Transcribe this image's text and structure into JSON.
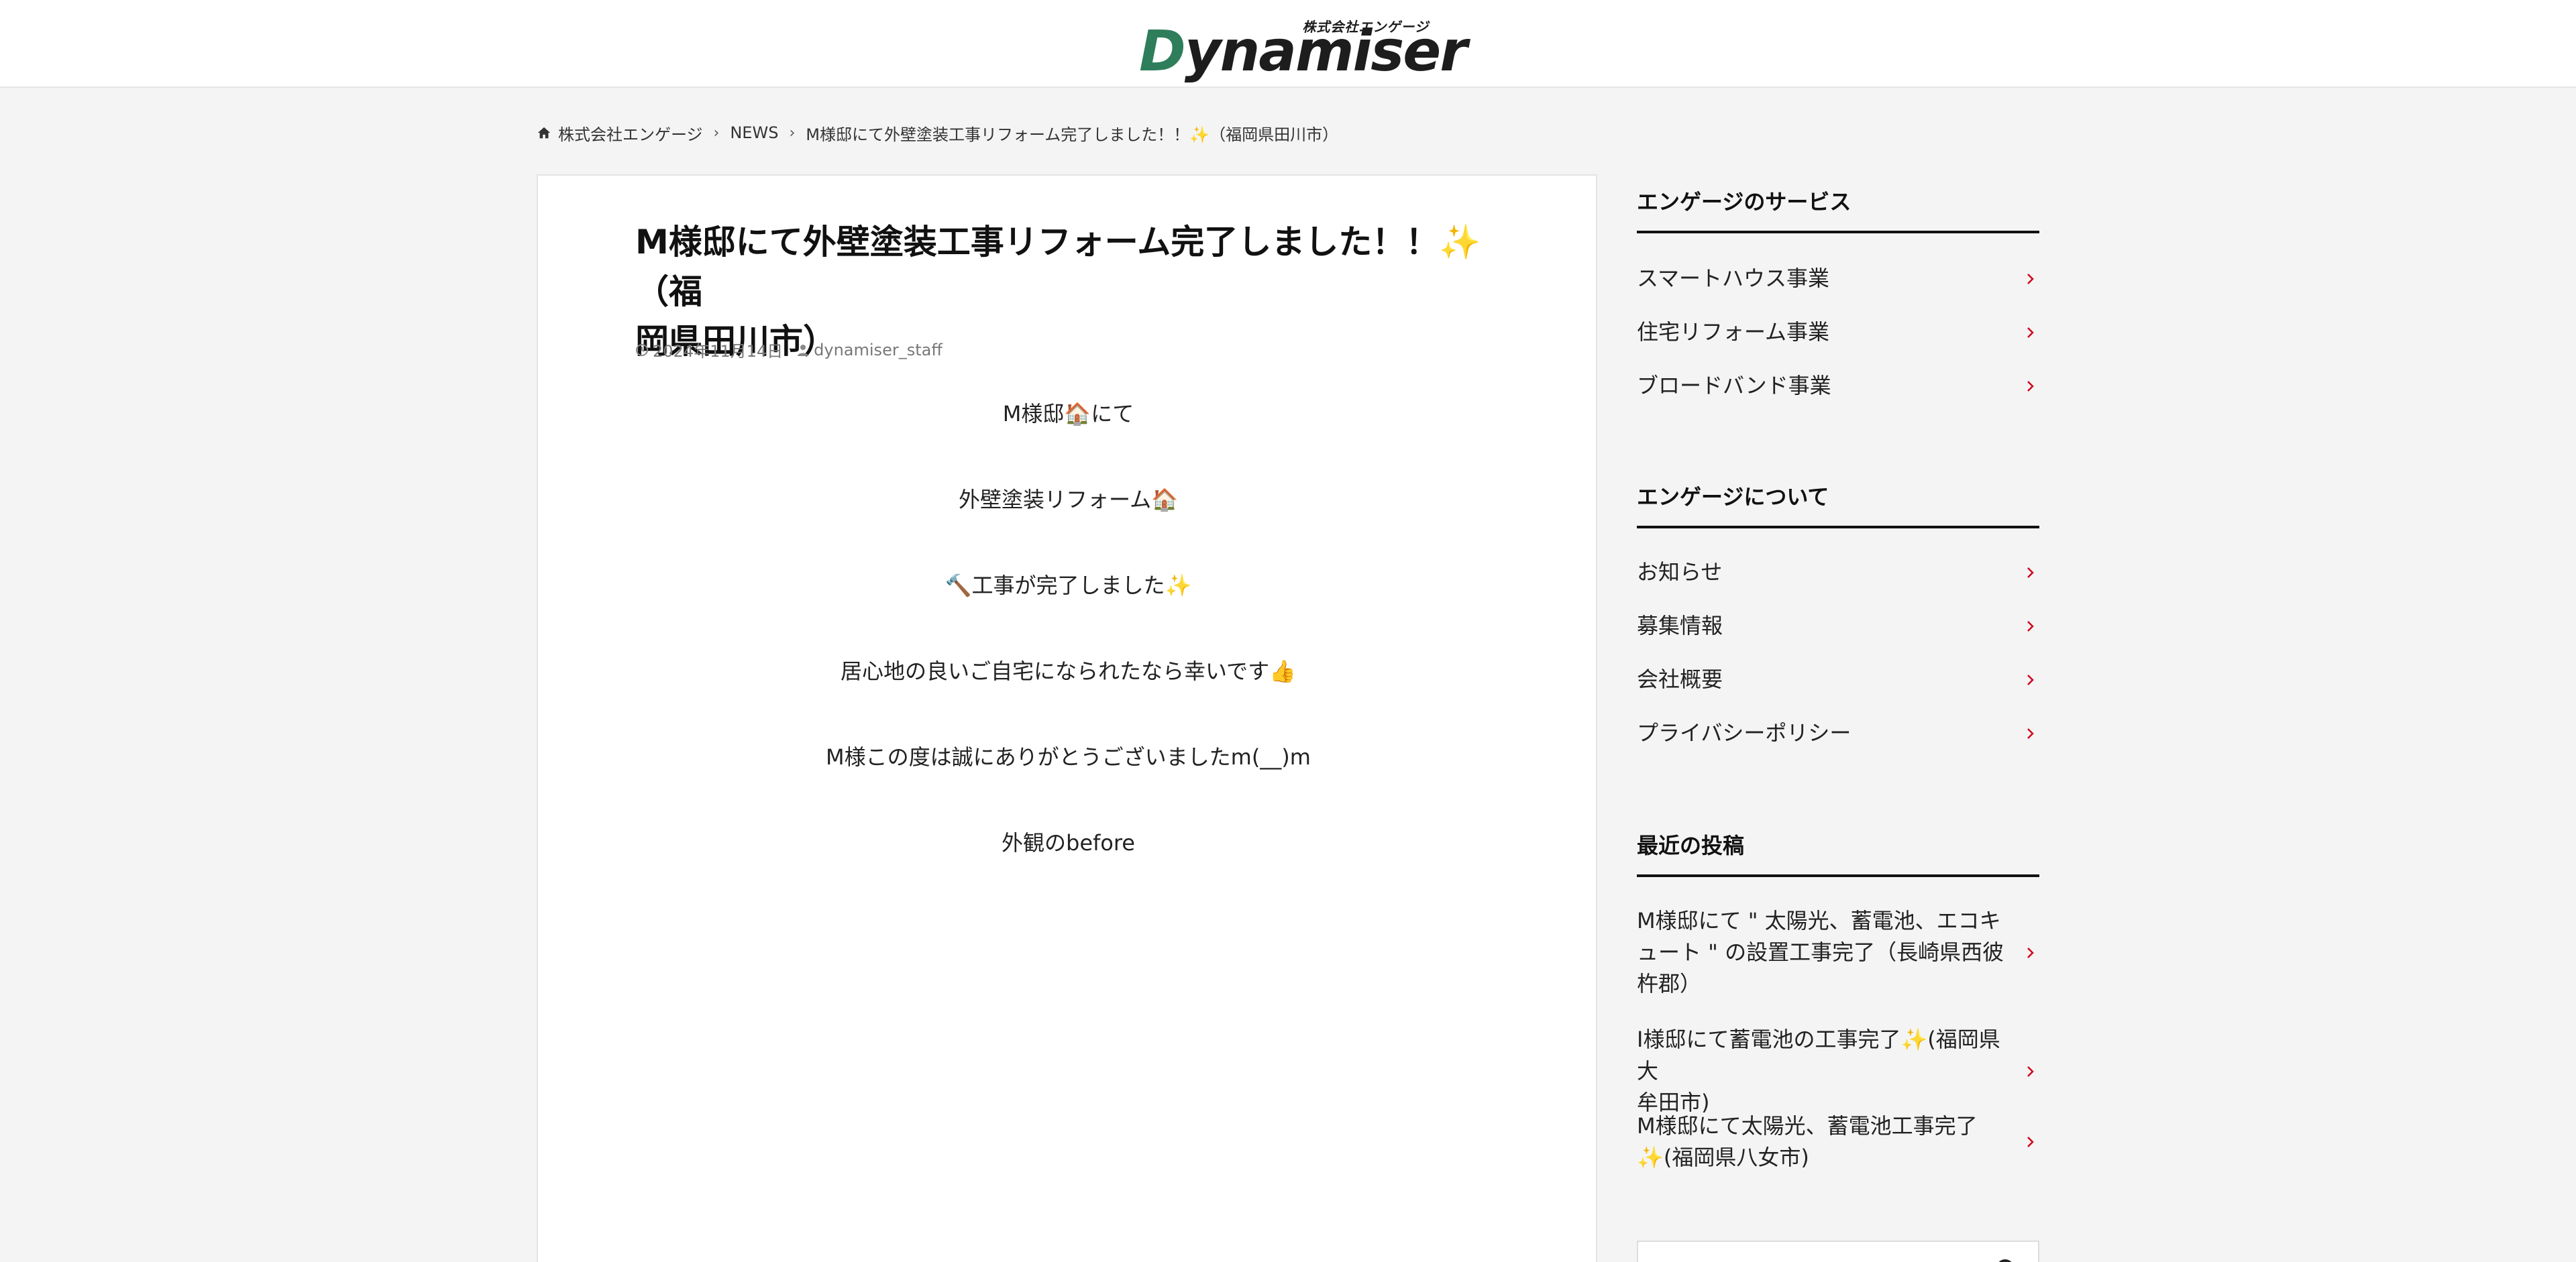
{
  "header": {
    "logo_kana": "株式会社エンゲージ",
    "logo_word_accent": "D",
    "logo_word_rest": "ynamiser"
  },
  "breadcrumb": {
    "home": "株式会社エンゲージ",
    "category": "NEWS",
    "current": "M様邸にて外壁塗装工事リフォーム完了しました！！✨（福岡県田川市）"
  },
  "article": {
    "title_line1": "M様邸にて外壁塗装工事リフォーム完了しました！！✨（福",
    "title_line2": "岡県田川市）",
    "date": "2024年11月14日",
    "author": "dynamiser_staff",
    "lines": [
      "M様邸🏠にて",
      "外壁塗装リフォーム🏠",
      "🔨工事が完了しました✨",
      "居心地の良いご自宅になられたなら幸いです👍",
      "M様この度は誠にありがとうございましたm(__)m",
      "外観のbefore"
    ]
  },
  "sidebar": {
    "services": {
      "title": "エンゲージのサービス",
      "items": [
        "スマートハウス事業",
        "住宅リフォーム事業",
        "ブロードバンド事業"
      ]
    },
    "about": {
      "title": "エンゲージについて",
      "items": [
        "お知らせ",
        "募集情報",
        "会社概要",
        "プライバシーポリシー"
      ]
    },
    "recent": {
      "title": "最近の投稿",
      "items": [
        [
          "M様邸にて \" 太陽光、蓄電池、エコキ",
          "ュート \" の設置工事完了（長崎県西彼",
          "杵郡）"
        ],
        [
          "I様邸にて蓄電池の工事完了✨(福岡県大",
          "牟田市)"
        ],
        [
          "M様邸にて太陽光、蓄電池工事完了",
          "✨(福岡県八女市)"
        ]
      ]
    }
  },
  "colors": {
    "accent_green": "#2e7d5b",
    "chevron_red": "#d0021b",
    "background": "#f4f4f4"
  },
  "icons": {
    "home": "home-icon",
    "clock": "clock-icon",
    "user": "user-icon",
    "chevron": "chevron-right-icon",
    "search": "search-icon"
  }
}
